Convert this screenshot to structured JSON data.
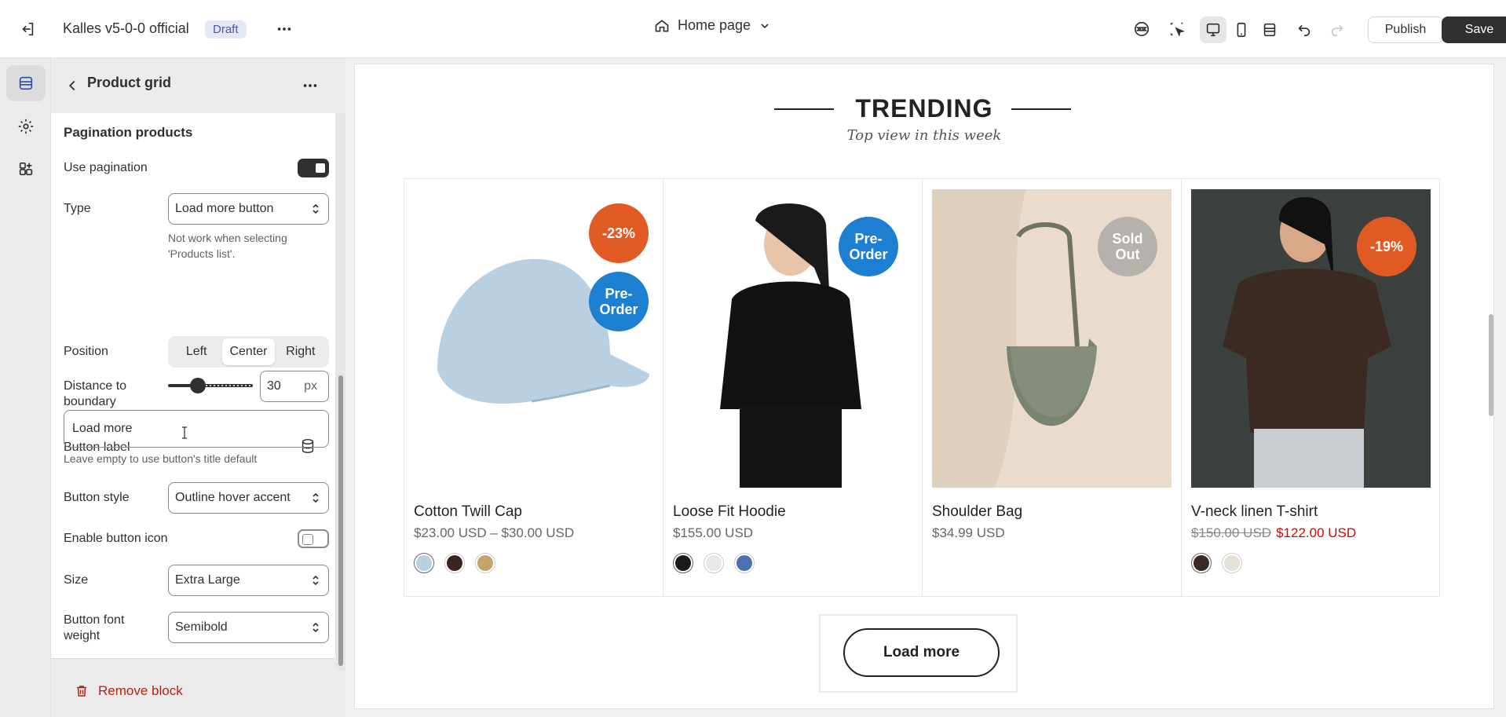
{
  "topbar": {
    "store_name": "Kalles v5-0-0 official",
    "status_badge": "Draft",
    "page_select": "Home page",
    "publish_label": "Publish",
    "save_label": "Save"
  },
  "sidebar": {
    "header_title": "Product grid",
    "section_title": "Pagination products",
    "use_pagination_label": "Use pagination",
    "use_pagination_on": true,
    "type_label": "Type",
    "type_value": "Load more button",
    "type_help": "Not work when selecting 'Products list'.",
    "position_label": "Position",
    "position_options": [
      "Left",
      "Center",
      "Right"
    ],
    "position_selected": "Center",
    "distance_label": "Distance to boundary",
    "distance_value": "30",
    "distance_unit": "px",
    "button_label_label": "Button label",
    "button_label_value": "Load more",
    "button_label_help": "Leave empty to use button's title default",
    "button_style_label": "Button style",
    "button_style_value": "Outline hover accent",
    "enable_icon_label": "Enable button icon",
    "enable_icon_on": false,
    "size_label": "Size",
    "size_value": "Extra Large",
    "font_weight_label": "Button font weight",
    "font_weight_value": "Semibold",
    "remove_label": "Remove block"
  },
  "preview": {
    "heading": "TRENDING",
    "subheading": "Top view in this week",
    "load_more_label": "Load more",
    "products": [
      {
        "name": "Cotton Twill Cap",
        "price": "$23.00 USD – $30.00 USD",
        "badges": [
          "-23%",
          "Pre-\nOrder"
        ],
        "swatches": [
          "#b8d0e0",
          "#3a2520",
          "#c5a36b"
        ]
      },
      {
        "name": "Loose Fit Hoodie",
        "price": "$155.00 USD",
        "badges": [
          "Pre-\nOrder"
        ],
        "swatches": [
          "#1a1a1a",
          "#e8e8e8",
          "#4a72b0"
        ]
      },
      {
        "name": "Shoulder Bag",
        "price": "$34.99 USD",
        "badges": [
          "Sold\nOut"
        ],
        "swatches": []
      },
      {
        "name": "V-neck linen T-shirt",
        "price_old": "$150.00 USD",
        "price_new": "$122.00 USD",
        "badges": [
          "-19%"
        ],
        "swatches": [
          "#3a2a22",
          "#e5e0d8"
        ]
      }
    ]
  },
  "colors": {
    "sale_badge": "#e15a24",
    "preorder_badge": "#1c7fd1",
    "soldout_badge": "#b5b1ac",
    "sale_price": "#dd0000",
    "remove_text": "#b42318"
  }
}
